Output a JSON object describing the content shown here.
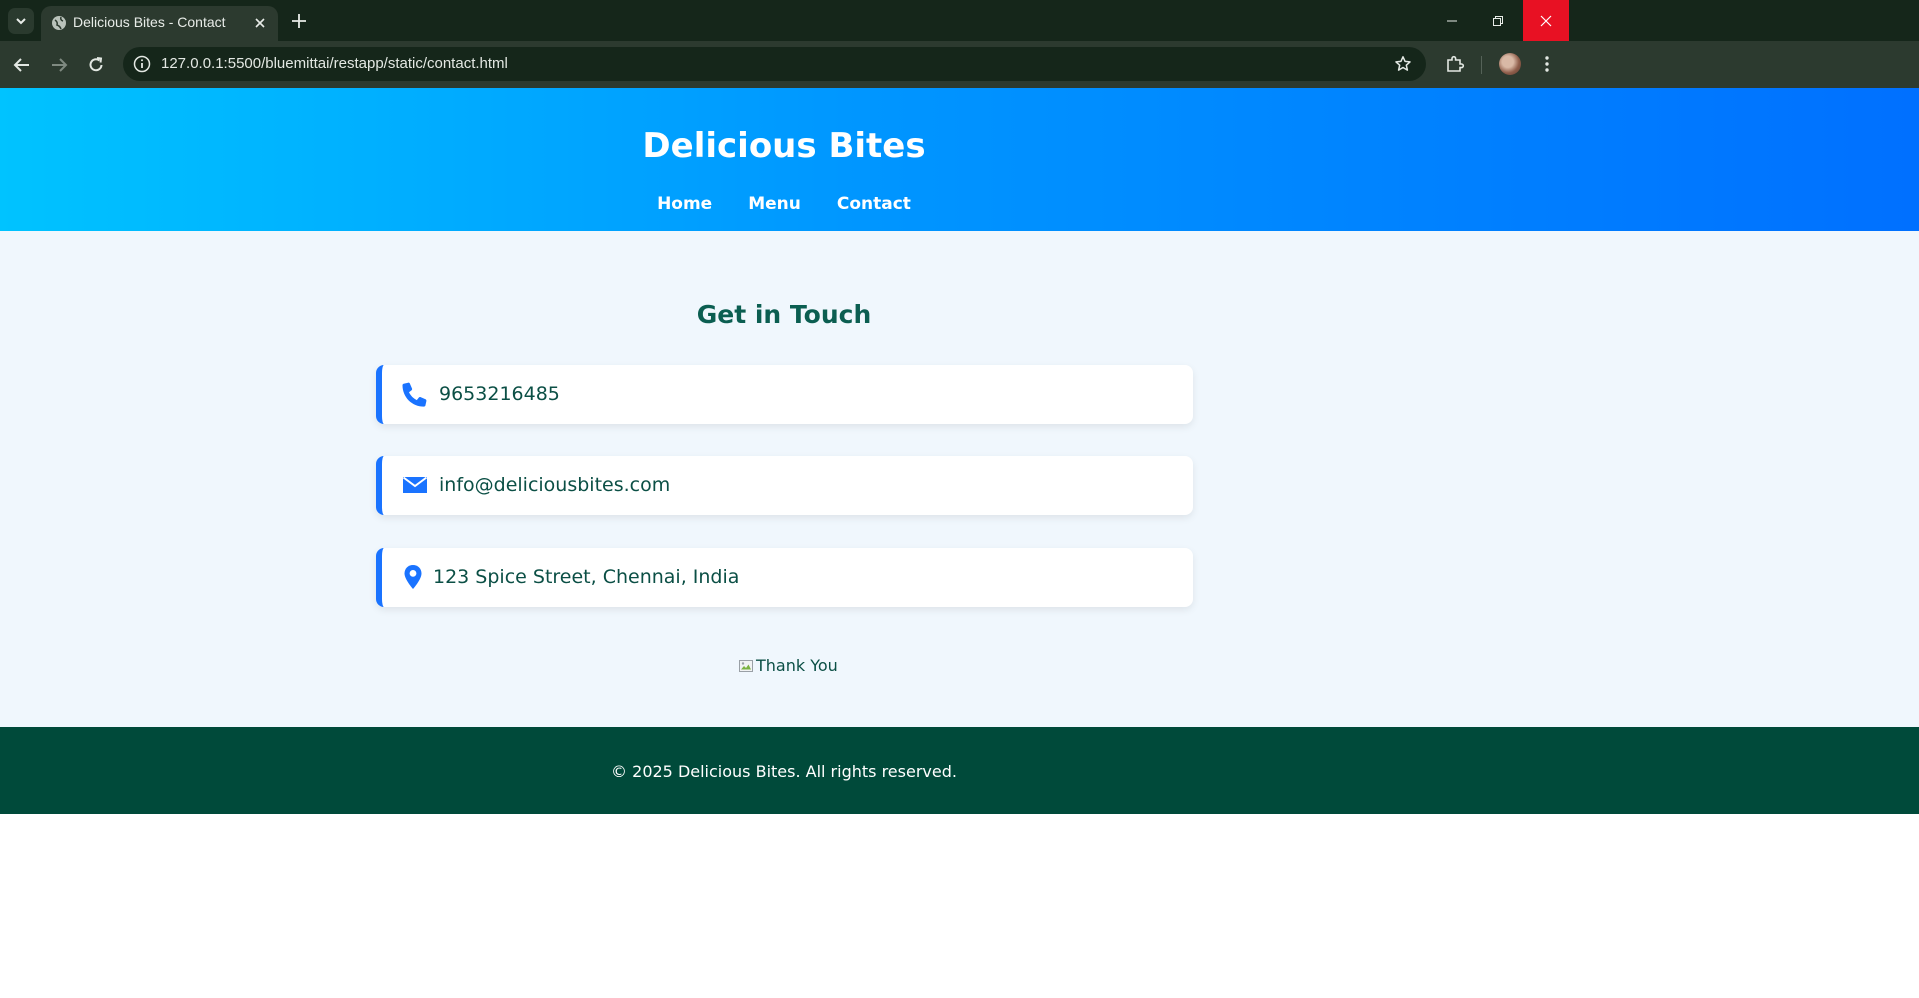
{
  "browser": {
    "tab_title": "Delicious Bites - Contact",
    "url": "127.0.0.1:5500/bluemittai/restapp/static/contact.html"
  },
  "header": {
    "site_title": "Delicious Bites",
    "nav": [
      "Home",
      "Menu",
      "Contact"
    ]
  },
  "contact": {
    "title": "Get in Touch",
    "phone": "9653216485",
    "email": "info@deliciousbites.com",
    "address": "123 Spice Street, Chennai, India"
  },
  "thank_you_alt": "Thank You",
  "footer": {
    "text": "© 2025 Delicious Bites. All rights reserved."
  },
  "colors": {
    "accent": "#1a73ff",
    "heading": "#0b5e51",
    "footer_bg": "#004a3a",
    "header_gradient_start": "#00c3ff",
    "header_gradient_end": "#0070ff"
  },
  "icons": {
    "phone": "phone-icon",
    "email": "envelope-icon",
    "address": "map-pin-icon"
  }
}
